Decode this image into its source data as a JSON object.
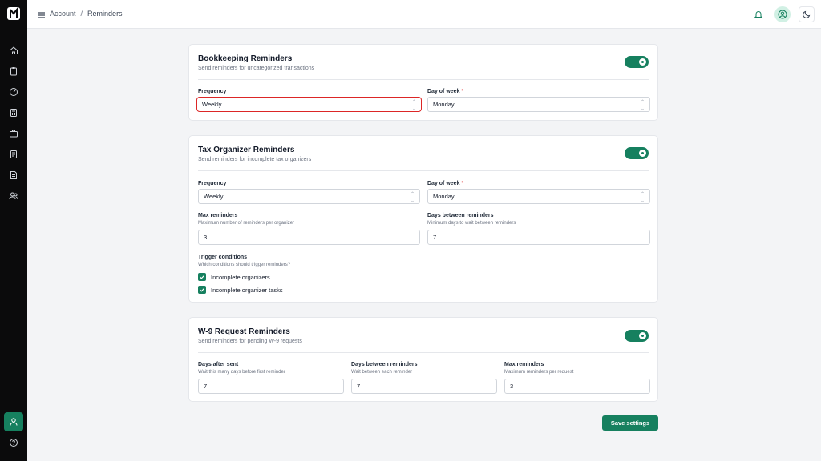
{
  "colors": {
    "accent": "#16805f",
    "sidebar": "#0b0b0c",
    "required": "#dc2626"
  },
  "breadcrumb": {
    "parent": "Account",
    "separator": "/",
    "current": "Reminders"
  },
  "sidebar": {
    "items": [
      {
        "icon": "home-icon"
      },
      {
        "icon": "clipboard-icon"
      },
      {
        "icon": "gauge-icon"
      },
      {
        "icon": "calculator-icon"
      },
      {
        "icon": "briefcase-icon"
      },
      {
        "icon": "document-icon"
      },
      {
        "icon": "file-text-icon"
      },
      {
        "icon": "users-icon"
      }
    ],
    "bottom": [
      {
        "icon": "user-icon"
      },
      {
        "icon": "help-icon"
      }
    ]
  },
  "bookkeeping": {
    "title": "Bookkeeping Reminders",
    "subtitle": "Send reminders for uncategorized transactions",
    "enabled": true,
    "frequency_label": "Frequency",
    "frequency_value": "Weekly",
    "day_label": "Day of week",
    "day_required": "*",
    "day_value": "Monday"
  },
  "tax": {
    "title": "Tax Organizer Reminders",
    "subtitle": "Send reminders for incomplete tax organizers",
    "enabled": true,
    "frequency_label": "Frequency",
    "frequency_value": "Weekly",
    "day_label": "Day of week",
    "day_required": "*",
    "day_value": "Monday",
    "max_label": "Max reminders",
    "max_hint": "Maximum number of reminders per organizer",
    "max_value": "3",
    "between_label": "Days between reminders",
    "between_hint": "Minimum days to wait between reminders",
    "between_value": "7",
    "trigger_label": "Trigger conditions",
    "trigger_hint": "Which conditions should trigger reminders?",
    "triggers": [
      {
        "label": "Incomplete organizers",
        "checked": true
      },
      {
        "label": "Incomplete organizer tasks",
        "checked": true
      }
    ]
  },
  "w9": {
    "title": "W-9 Request Reminders",
    "subtitle": "Send reminders for pending W-9 requests",
    "enabled": true,
    "after_label": "Days after sent",
    "after_hint": "Wait this many days before first reminder",
    "after_value": "7",
    "between_label": "Days between reminders",
    "between_hint": "Wait between each reminder",
    "between_value": "7",
    "max_label": "Max reminders",
    "max_hint": "Maximum reminders per request",
    "max_value": "3"
  },
  "save_label": "Save settings"
}
